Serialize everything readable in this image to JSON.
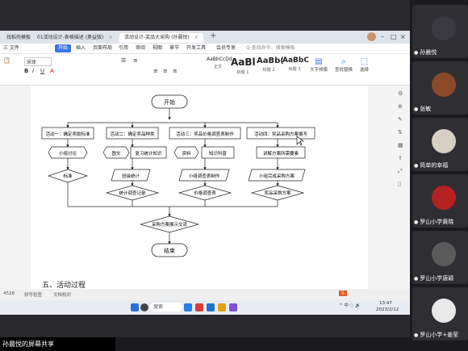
{
  "tabs": [
    {
      "label": "找稻壳模板",
      "active": false
    },
    {
      "label": "01活动设计-表格描述 (奥益版)",
      "active": false
    },
    {
      "label": "活动设计-奖品大采购 (孙晨悦)",
      "active": true
    }
  ],
  "menu": [
    "三 文件",
    "开始",
    "插入",
    "页面布局",
    "引用",
    "审阅",
    "视图",
    "章节",
    "开发工具",
    "会员专享",
    "Q 查找命令、搜索模板"
  ],
  "ribbon": {
    "font_name": "宋体",
    "styles": [
      {
        "preview": "AaBbCcDd",
        "label": "正文"
      },
      {
        "preview": "AaBl",
        "label": "标题 1"
      },
      {
        "preview": "AaBb(",
        "label": "标题 2"
      },
      {
        "preview": "AaBbC",
        "label": "标题 3"
      }
    ],
    "text_layout": "文字排版",
    "find_replace": "查找替换",
    "select": "选择"
  },
  "flowchart": {
    "start": "开始",
    "activities": [
      "活动一：确定奖励标准",
      "活动二：确定奖品种类",
      "活动三：奖品价格调查表制作",
      "活动四：奖品采购方案撰写"
    ],
    "methods": [
      "小组讨论",
      "图文",
      "复习统计知识",
      "资料",
      "知识科普",
      "讲解方案所需要素"
    ],
    "outputs": [
      "标准",
      "班级统计",
      "小组调查表制作",
      "小组完成采购方案"
    ],
    "results": [
      "统计调查记录",
      "价格调查表",
      "奖品采购方案"
    ],
    "exchange": "采购方案展示交流",
    "end": "结束",
    "next_heading": "五、活动过程"
  },
  "status": {
    "page": "4528",
    "spell": "拼写检查",
    "proof": "文档校对"
  },
  "taskbar": {
    "search": "搜索",
    "time": "13:47",
    "date": "2023/2/12"
  },
  "share_label": "孙晨悦的屏幕共享",
  "participants": [
    {
      "name": "孙晨悦",
      "color": "#3a3a40"
    },
    {
      "name": "张敏",
      "color": "#8a4a2a"
    },
    {
      "name": "简单的幸福",
      "color": "#d6cfc4"
    },
    {
      "name": "罗山小学黄晓",
      "color": "#b52020"
    },
    {
      "name": "罗山小学唐颖",
      "color": "#5a5a5a"
    },
    {
      "name": "罗山小学+姜莹",
      "color": "#e8e8e8"
    }
  ]
}
